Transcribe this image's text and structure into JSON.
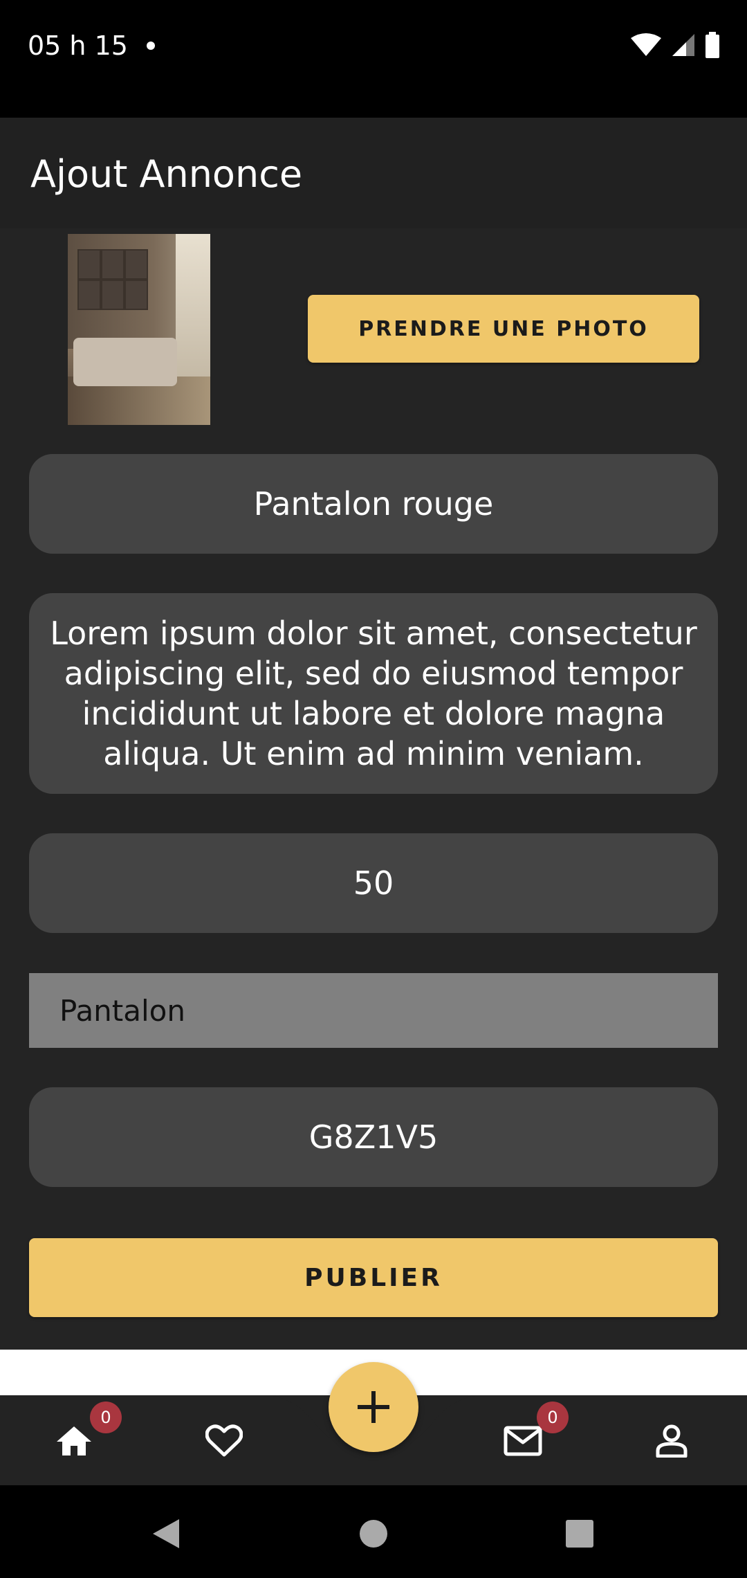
{
  "status_bar": {
    "time": "05 h 15"
  },
  "app_bar": {
    "title": "Ajout Annonce"
  },
  "form": {
    "photo_button": "PRENDRE UNE PHOTO",
    "title_value": "Pantalon rouge",
    "description_value": "Lorem ipsum dolor sit amet, consectetur adipiscing elit, sed do eiusmod tempor incididunt ut labore et dolore magna aliqua. Ut enim ad minim veniam.",
    "price_value": "50",
    "category_selected": "Pantalon",
    "postal_code_value": "G8Z1V5",
    "publish_button": "PUBLIER"
  },
  "bottom_nav": {
    "items": [
      {
        "icon": "home-icon",
        "badge": "0"
      },
      {
        "icon": "heart-icon"
      },
      {
        "icon": "add-icon"
      },
      {
        "icon": "mail-icon",
        "badge": "0"
      },
      {
        "icon": "account-icon"
      }
    ]
  },
  "colors": {
    "accent": "#f0c76a",
    "background": "#242424",
    "field": "#444444",
    "badge": "#a9363f"
  }
}
